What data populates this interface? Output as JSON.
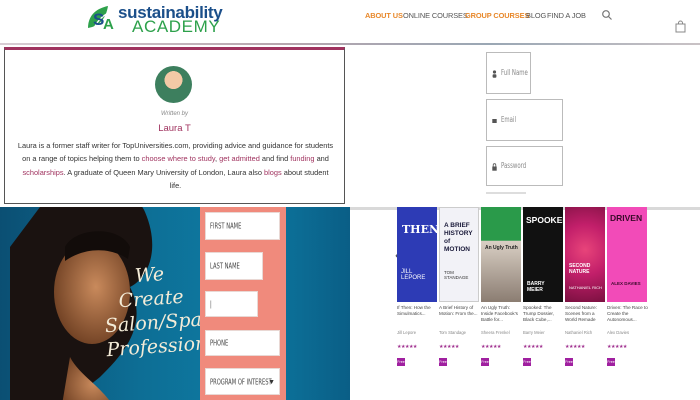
{
  "header": {
    "logo_line1": "sustainability",
    "logo_line2": "ACADEMY",
    "nav": [
      "ABOUT US",
      "ONLINE COURSES",
      "GROUP COURSES",
      "BLOG",
      "FIND A JOB"
    ],
    "accent_color": "#e8882a"
  },
  "author": {
    "written_by": "Written by",
    "name": "Laura T",
    "bio": [
      "Laura is a former staff writer for TopUniversities.com, providing advice and guidance for students on a range of topics helping them to ",
      "choose where to study",
      ", ",
      "get admitted",
      " and find ",
      "funding",
      " and ",
      "scholarships",
      ". A graduate of Queen Mary University of London, Laura also ",
      "blogs",
      " about student life."
    ],
    "accent_color": "#a0335f"
  },
  "signup_form": {
    "full_name_placeholder": "Full Name",
    "email_placeholder": "Email",
    "password_placeholder": "Password"
  },
  "banner": {
    "headline": "We Create Salon/Spa Professionals",
    "fields": {
      "first_name": "FIRST NAME",
      "last_name": "LAST NAME",
      "blank": "|",
      "phone": "PHONE",
      "program": "PROGRAM OF INTEREST"
    },
    "form_color": "#f08a7c"
  },
  "books": [
    {
      "cover_text": "THEN",
      "cover_author": "JILL LEPORE",
      "title": "If Then: How the Simulmatics...",
      "author": "Jill Lepore",
      "stars": "★★★★★",
      "badge": "Free",
      "cover_color": "#2d3bb5"
    },
    {
      "cover_text": "A BRIEF HISTORY of MOTION",
      "cover_author": "TOM STANDAGE",
      "title": "A Brief History of Motion: From the...",
      "author": "Tom Standage",
      "stars": "★★★★★",
      "badge": "Free",
      "cover_color": "#f2f2f7"
    },
    {
      "cover_text": "An Ugly Truth",
      "cover_author": "",
      "title": "An Ugly Truth: Inside Facebook's Battle for...",
      "author": "Sheera Frenkel",
      "stars": "★★★★★",
      "badge": "Free",
      "cover_color": "#2a9a4a"
    },
    {
      "cover_text": "SPOOKED",
      "cover_author": "BARRY MEIER",
      "title": "Spooked: The Trump Dossier, Black Cube,...",
      "author": "Barry Meier",
      "stars": "★★★★★",
      "badge": "Free",
      "cover_color": "#111111"
    },
    {
      "cover_text": "SECOND NATURE",
      "cover_author": "NATHANIEL RICH",
      "title": "Second Nature: Scenes from a World Remade",
      "author": "Nathaniel Rich",
      "stars": "★★★★★",
      "badge": "Free",
      "cover_color": "#c21f6a"
    },
    {
      "cover_text": "DRIVEN",
      "cover_author": "ALEX DAVIES",
      "title": "Driven: The Race to Create the Autonomous...",
      "author": "Alex Davies",
      "stars": "★★★★★",
      "badge": "Free",
      "cover_color": "#f24bb8"
    }
  ]
}
